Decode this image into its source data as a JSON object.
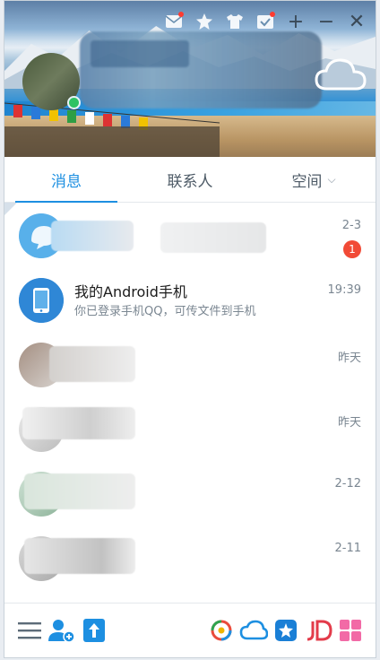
{
  "tabs": [
    {
      "label": "消息",
      "active": true
    },
    {
      "label": "联系人",
      "active": false
    },
    {
      "label": "空间",
      "active": false
    }
  ],
  "tab_caret": "⌵",
  "conversations": [
    {
      "name": "",
      "preview": "",
      "time": "2-3",
      "badge": "1"
    },
    {
      "name": "我的Android手机",
      "preview": "你已登录手机QQ，可传文件到手机",
      "time": "19:39",
      "badge": ""
    },
    {
      "name": "",
      "preview": "",
      "time": "昨天",
      "badge": ""
    },
    {
      "name": "",
      "preview": "",
      "time": "昨天",
      "badge": ""
    },
    {
      "name": "",
      "preview": "",
      "time": "2-12",
      "badge": ""
    },
    {
      "name": "",
      "preview": "",
      "time": "2-11",
      "badge": ""
    }
  ],
  "title_icons": [
    "mail-icon",
    "star-icon",
    "shirt-icon",
    "task-icon"
  ],
  "window_buttons": {
    "add": "+",
    "minimize": "−",
    "close": "✕"
  },
  "colors": {
    "accent": "#1d8fe1",
    "badge": "#f14a36",
    "online": "#2ec264"
  }
}
